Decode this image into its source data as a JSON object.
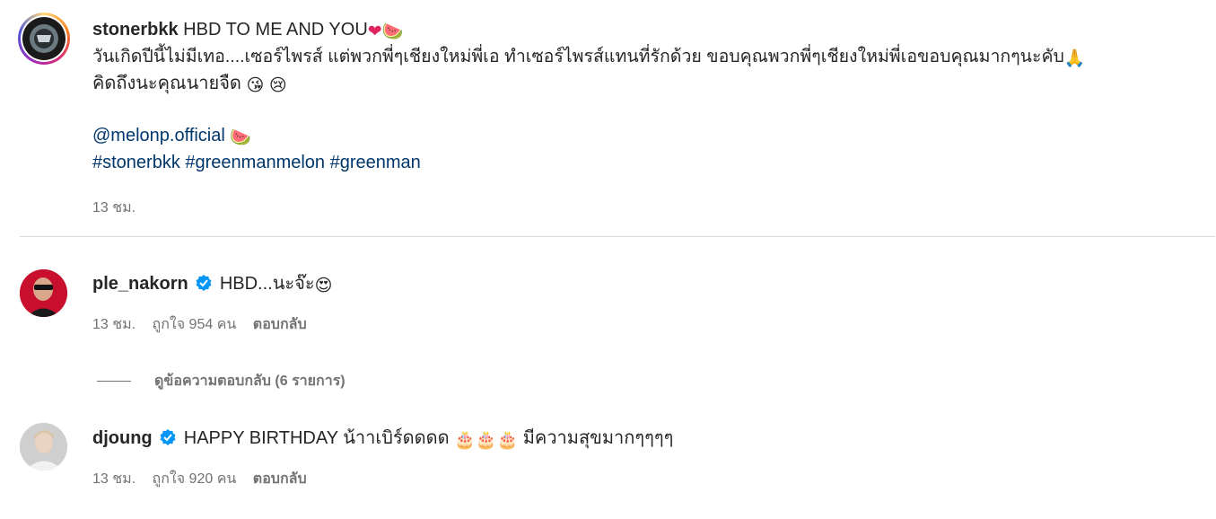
{
  "post": {
    "username": "stonerbkk",
    "title_line": "HBD TO ME AND YOU",
    "title_emojis": [
      "❤",
      "🍉"
    ],
    "body_line1": "วันเกิดปีนี้ไม่มีเทอ....เซอร์ไพรส์ แต่พวกพี่ๆเชียงใหม่พี่เอ ทำเซอร์ไพรส์แทนที่รักด้วย ขอบคุณพวกพี่ๆเชียงใหม่พี่เอขอบคุณมากๆนะคับ",
    "body_line1_emoji": "🙏",
    "body_line2": "คิดถึงนะคุณนายจืด",
    "body_line2_emojis": [
      "😘",
      "😢"
    ],
    "mention": "@melonp.official",
    "mention_emoji": "🍉",
    "hashtags": "#stonerbkk #greenmanmelon #greenman",
    "time": "13 ชม."
  },
  "comments": [
    {
      "username": "ple_nakorn",
      "verified": true,
      "text": "HBD...นะจ๊ะ",
      "emoji": "😍",
      "time": "13 ชม.",
      "likes": "ถูกใจ 954 คน",
      "reply_label": "ตอบกลับ",
      "view_replies": "ดูข้อความตอบกลับ (6 รายการ)"
    },
    {
      "username": "djoung",
      "verified": true,
      "text": "HAPPY BIRTHDAY น้าาเบิร์ดดดด",
      "emojis": [
        "🎂",
        "🎂",
        "🎂"
      ],
      "text_after": "มีความสุขมากๆๆๆๆ",
      "time": "13 ชม.",
      "likes": "ถูกใจ 920 คน",
      "reply_label": "ตอบกลับ"
    }
  ],
  "colors": {
    "link": "#00376b",
    "meta": "#737373",
    "verified": "#0095f6",
    "divider": "#dbdbdb"
  }
}
